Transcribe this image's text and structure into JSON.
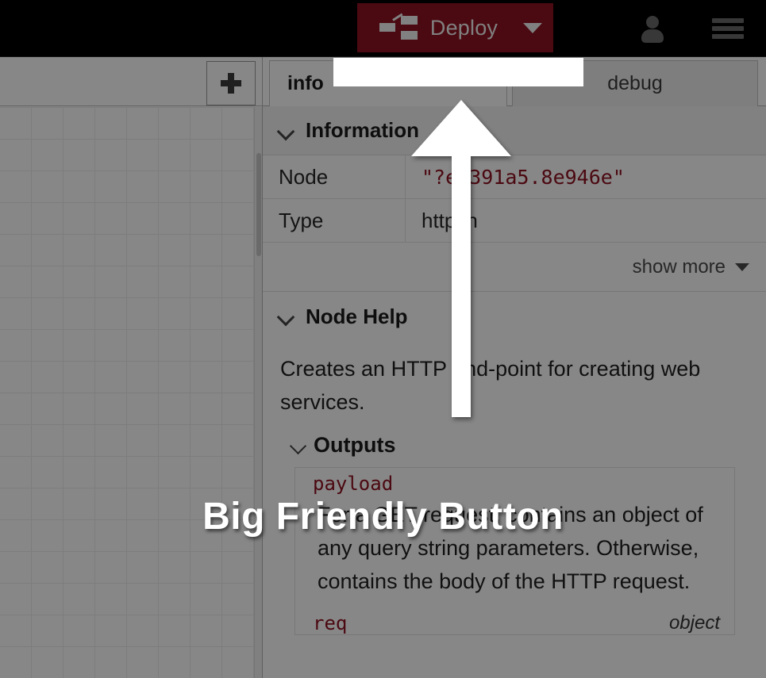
{
  "header": {
    "deploy_label": "Deploy",
    "deploy_icon": "deploy-nodes-icon",
    "deploy_caret_icon": "chevron-down-icon",
    "user_icon": "user-icon",
    "menu_icon": "hamburger-menu-icon",
    "accent_color": "#8f1220",
    "bar_color": "#000000"
  },
  "workspace": {
    "add_tab_label": "+",
    "add_tab_icon": "plus-icon"
  },
  "sidebar": {
    "tabs": [
      {
        "label": "info",
        "active": true
      },
      {
        "label": "debug",
        "active": false
      }
    ],
    "information": {
      "section_title": "Information",
      "chevron_icon": "chevron-down-icon",
      "rows": [
        {
          "key": "Node",
          "value": "\"?e8391a5.8e946e\""
        },
        {
          "key": "Type",
          "value": "http in"
        }
      ],
      "show_more_label": "show more",
      "show_more_icon": "caret-down-icon"
    },
    "node_help": {
      "section_title": "Node Help",
      "chevron_icon": "chevron-down-icon",
      "description": "Creates an HTTP end-point for creating web services.",
      "outputs_title": "Outputs",
      "outputs": [
        {
          "name": "payload",
          "type": "",
          "description": "For a GET request, contains an object of any query string parameters. Otherwise, contains the body of the HTTP request."
        },
        {
          "name": "req",
          "type": "object",
          "description": ""
        }
      ]
    }
  },
  "tour": {
    "caption": "Big Friendly Button",
    "arrow_icon": "up-arrow-pointer",
    "arrow_color": "#ffffff",
    "dim_color": "rgba(0,0,0,0.47)",
    "target": "deploy-button"
  }
}
